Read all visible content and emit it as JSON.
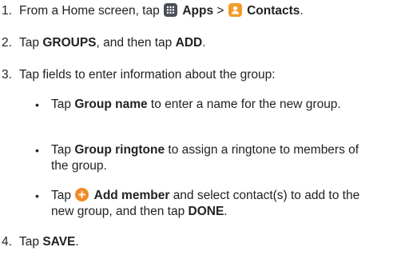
{
  "steps": [
    {
      "num": "1.",
      "pre": "From a Home screen, tap",
      "apps_label": "Apps",
      "sep": ">",
      "contacts_label": "Contacts",
      "post": "."
    },
    {
      "num": "2.",
      "pre": "Tap",
      "groups_label": "GROUPS",
      "mid": ", and then tap",
      "add_label": "ADD",
      "post": "."
    },
    {
      "num": "3.",
      "text": "Tap fields to enter information about the group:",
      "bullets": [
        {
          "pre": "Tap",
          "bold": "Group name",
          "post": "to enter a name for the new group."
        },
        {
          "pre": "Tap",
          "bold": "Group ringtone",
          "post": "to assign a ringtone to members of the group."
        },
        {
          "pre": "Tap",
          "bold": "Add member",
          "post": "and select contact(s) to add to the new group, and then tap",
          "bold2": "DONE",
          "end": "."
        }
      ]
    },
    {
      "num": "4.",
      "pre": "Tap",
      "save_label": "SAVE",
      "post": "."
    }
  ],
  "icons": {
    "apps": "apps-grid-icon",
    "contacts": "contacts-person-icon",
    "add_member": "add-circle-icon"
  },
  "colors": {
    "text": "#222222",
    "apps_icon_bg": "#4a4f57",
    "contacts_icon_bg": "#f39c25",
    "add_icon_bg": "#f08a24"
  }
}
